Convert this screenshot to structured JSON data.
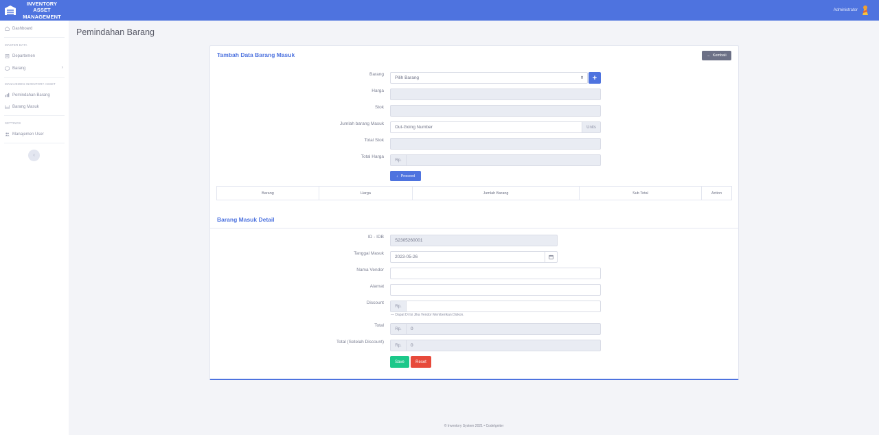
{
  "brand": {
    "title": "INVENTORY ASSET MANAGEMENT",
    "icon": "warehouse-icon"
  },
  "header": {
    "user_name": "Administrator",
    "colors": {
      "topbar": "#4e73df"
    }
  },
  "sidebar": {
    "items": [
      {
        "label": "Dashboard",
        "icon": "home-icon"
      },
      {
        "label": "Departemen",
        "icon": "building-icon"
      },
      {
        "label": "Barang",
        "icon": "box-icon"
      },
      {
        "label": "Pemindahan Barang",
        "icon": "chart-icon"
      },
      {
        "label": "Barang Masuk",
        "icon": "inbox-icon"
      },
      {
        "label": "Manajemen User",
        "icon": "users-icon"
      }
    ],
    "headings": {
      "master": "MASTER DATA",
      "manajemen": "MANAJEMEN INVENTORY ASSET",
      "settings": "SETTINGS"
    }
  },
  "page": {
    "title": "Pemindahan Barang"
  },
  "form": {
    "title": "Tambah Data Barang Masuk",
    "back_label": "Kembali",
    "labels": {
      "barang": "Barang",
      "harga": "Harga",
      "stok": "Stok",
      "jumlah": "Jumlah barang Masuk",
      "total_stok": "Total Stok",
      "total_harga": "Total Harga"
    },
    "barang_select": "Pilih Barang",
    "jumlah_placeholder": "Out-Going Number",
    "units": "Units",
    "rp": "Rp.",
    "proceed_label": "Proceed",
    "table_headers": [
      "Barang",
      "Harga",
      "Jumlah Barang",
      "Sub Total",
      "Action"
    ]
  },
  "detail": {
    "title": "Barang Masuk Detail",
    "labels": {
      "id": "ID - IDB",
      "tanggal": "Tanggal Masuk",
      "vendor": "Nama Vendor",
      "alamat": "Alamat",
      "discount": "Discount",
      "total": "Total",
      "total_discount": "Total (Setelah Discount)"
    },
    "id_value": "S2305260001",
    "tanggal_value": "2023-05-26",
    "hint": "— Dapat Di Isi Jika Vendor Memberikan Diskon.",
    "rp": "Rp.",
    "total_value": "0",
    "total_discount_value": "0",
    "save_label": "Save",
    "reset_label": "Reset"
  },
  "footer": {
    "text": "© Inventory System 2021 • CodeIgniter"
  }
}
